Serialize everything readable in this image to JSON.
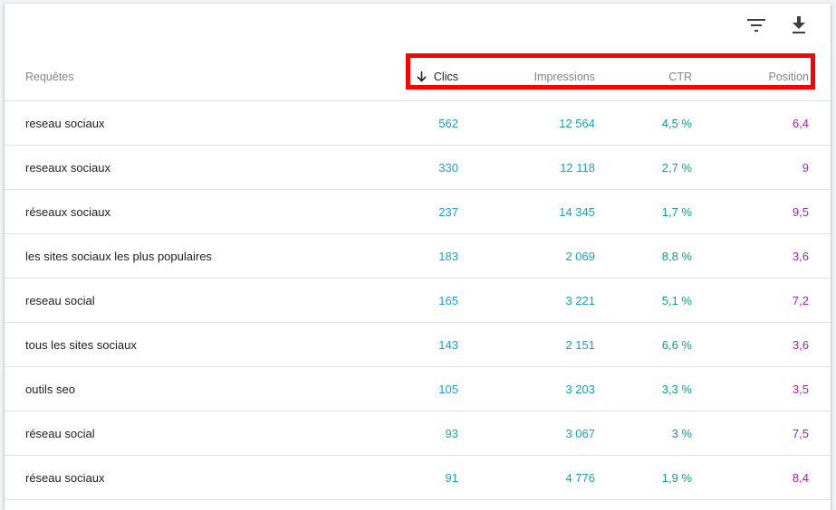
{
  "table": {
    "headers": {
      "query": "Requêtes",
      "clicks": "Clics",
      "impressions": "Impressions",
      "ctr": "CTR",
      "position": "Position"
    },
    "sort": {
      "column": "clicks",
      "direction": "descending",
      "icon": "arrow-down-icon"
    },
    "rows": [
      {
        "query": "reseau sociaux",
        "clicks": "562",
        "impressions": "12 564",
        "ctr": "4,5 %",
        "position": "6,4"
      },
      {
        "query": "reseaux sociaux",
        "clicks": "330",
        "impressions": "12 118",
        "ctr": "2,7 %",
        "position": "9"
      },
      {
        "query": "réseaux sociaux",
        "clicks": "237",
        "impressions": "14 345",
        "ctr": "1,7 %",
        "position": "9,5"
      },
      {
        "query": "les sites sociaux les plus populaires",
        "clicks": "183",
        "impressions": "2 069",
        "ctr": "8,8 %",
        "position": "3,6"
      },
      {
        "query": "reseau social",
        "clicks": "165",
        "impressions": "3 221",
        "ctr": "5,1 %",
        "position": "7,2"
      },
      {
        "query": "tous les sites sociaux",
        "clicks": "143",
        "impressions": "2 151",
        "ctr": "6,6 %",
        "position": "3,6"
      },
      {
        "query": "outils seo",
        "clicks": "105",
        "impressions": "3 203",
        "ctr": "3,3 %",
        "position": "3,5"
      },
      {
        "query": "réseau social",
        "clicks": "93",
        "impressions": "3 067",
        "ctr": "3 %",
        "position": "7,5"
      },
      {
        "query": "réseau sociaux",
        "clicks": "91",
        "impressions": "4 776",
        "ctr": "1,9 %",
        "position": "8,4"
      }
    ]
  },
  "toolbar": {
    "filter_icon": "filter-icon",
    "download_icon": "download-icon"
  },
  "colors": {
    "clicks": "#1a9fd0",
    "impressions": "#17a2c0",
    "ctr": "#0f9d8f",
    "position": "#9c27b0",
    "highlight": "#ff0000"
  }
}
